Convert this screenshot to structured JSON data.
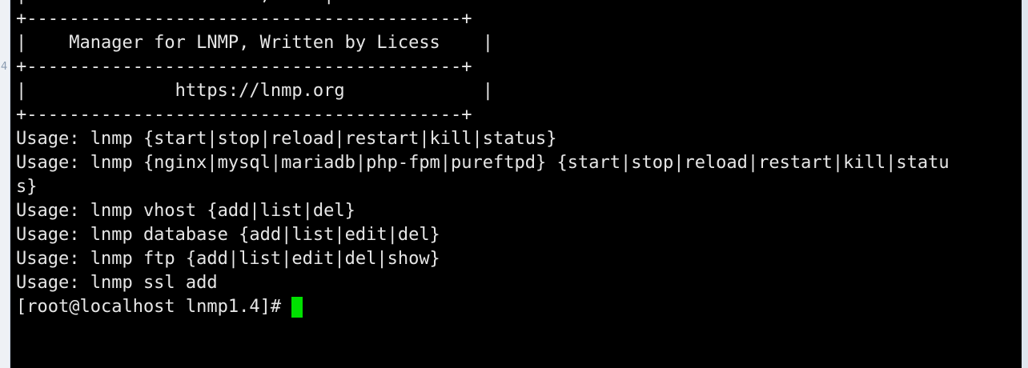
{
  "sidebar": {
    "mark": "4"
  },
  "terminal": {
    "lines": [
      "|        -             ;     |",
      "+-----------------------------------------+",
      "|    Manager for LNMP, Written by Licess    |",
      "+-----------------------------------------+",
      "|              https://lnmp.org             |",
      "+-----------------------------------------+",
      "Usage: lnmp {start|stop|reload|restart|kill|status}",
      "Usage: lnmp {nginx|mysql|mariadb|php-fpm|pureftpd} {start|stop|reload|restart|kill|statu",
      "s}",
      "Usage: lnmp vhost {add|list|del}",
      "Usage: lnmp database {add|list|edit|del}",
      "Usage: lnmp ftp {add|list|edit|del|show}",
      "Usage: lnmp ssl add"
    ],
    "prompt": "[root@localhost lnmp1.4]# ",
    "cursor_color": "#00e000",
    "background": "#000000",
    "foreground": "#e6e6e6"
  }
}
